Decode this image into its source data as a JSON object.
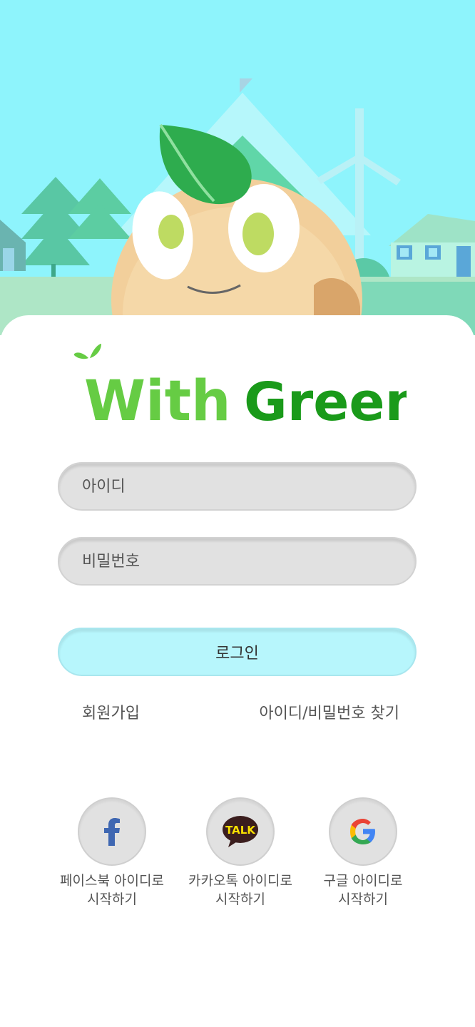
{
  "brand": {
    "word1": "With",
    "word2": "Green",
    "color_light": "#66cc44",
    "color_dark": "#1a9a1a"
  },
  "login": {
    "id_placeholder": "아이디",
    "password_placeholder": "비밀번호",
    "login_label": "로그인",
    "signup_label": "회원가입",
    "find_label": "아이디/비밀번호 찾기"
  },
  "social": [
    {
      "icon": "facebook-icon",
      "line1": "페이스북 아이디로",
      "line2": "시작하기"
    },
    {
      "icon": "kakaotalk-icon",
      "line1": "카카오톡 아이디로",
      "line2": "시작하기",
      "badge": "TALK"
    },
    {
      "icon": "google-icon",
      "line1": "구글 아이디로",
      "line2": "시작하기"
    }
  ],
  "colors": {
    "sky": "#8ef4fc",
    "login_button": "#b7f6fc",
    "input": "#e1e1e1"
  }
}
